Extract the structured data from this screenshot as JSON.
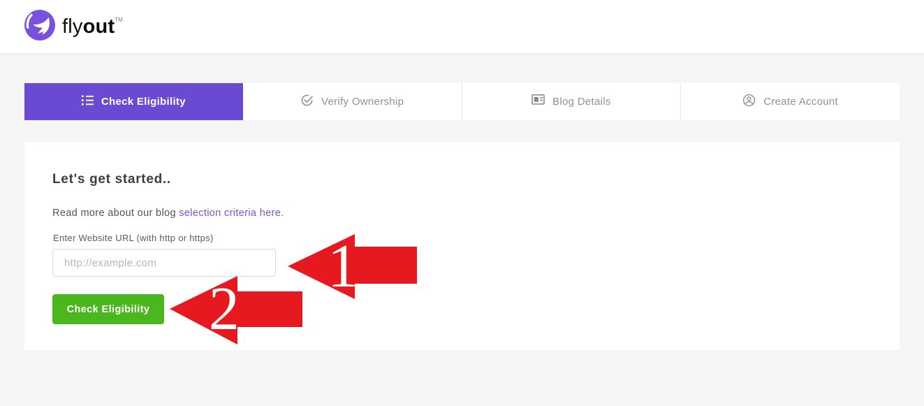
{
  "header": {
    "brand_light": "fly",
    "brand_bold": "out",
    "trademark": "TM"
  },
  "tabs": [
    {
      "label": "Check Eligibility",
      "icon": "list-icon",
      "active": true
    },
    {
      "label": "Verify Ownership",
      "icon": "check-circle-icon",
      "active": false
    },
    {
      "label": "Blog Details",
      "icon": "article-icon",
      "active": false
    },
    {
      "label": "Create Account",
      "icon": "account-circle-icon",
      "active": false
    }
  ],
  "main": {
    "heading": "Let's get started..",
    "intro_text": "Read more about our blog ",
    "intro_link": "selection criteria here.",
    "url_label": "Enter Website URL (with http or https)",
    "url_placeholder": "http://example.com",
    "url_value": "",
    "submit_label": "Check Eligibility"
  },
  "annotations": [
    {
      "number": "1",
      "target": "website-url-input"
    },
    {
      "number": "2",
      "target": "check-eligibility-button"
    }
  ],
  "colors": {
    "accent_purple": "#6a4ad2",
    "logo_purple": "#7a50df",
    "link_purple": "#7a52d1",
    "button_green": "#4bb71e",
    "annotation_red": "#e5191f",
    "page_background": "#f5f5f6"
  }
}
